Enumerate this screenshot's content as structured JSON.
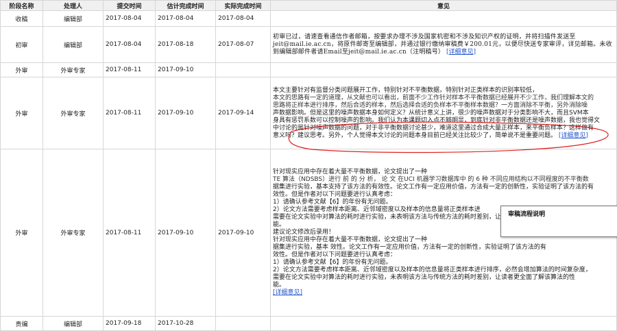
{
  "header": {
    "stage": "阶段名称",
    "handler": "处理人",
    "submitted": "提交时间",
    "estimated": "估计完成时间",
    "actual": "实际完成时间",
    "opinion": "意见"
  },
  "rows": [
    {
      "stage": "收稿",
      "handler": "编辑部",
      "submitted": "2017-08-04",
      "estimated": "2017-08-04",
      "actual": "2017-08-04",
      "opinion": ""
    },
    {
      "stage": "初审",
      "handler": "编辑部",
      "submitted": "2017-08-04",
      "estimated": "2017-08-18",
      "actual": "2017-08-07",
      "opinion": "初审已过，请速查看通信作者邮箱，按要求办理不涉及国家机密和不涉及知识产权的证明，并将扫描件发送至jeit@mail.ie.ac.cn，将原件邮寄至编辑部，并通过银行缴纳审稿费￥200.01元，以便尽快送专家审评，详见邮箱。未收到编辑部邮件者请Email至jeit@mail.ie.ac.cn（注明稿号）"
    },
    {
      "stage": "外审",
      "handler": "外审专家",
      "submitted": "2017-08-11",
      "estimated": "2017-09-10",
      "actual": "",
      "opinion": ""
    },
    {
      "stage": "外审",
      "handler": "外审专家",
      "submitted": "2017-08-11",
      "estimated": "2017-09-10",
      "actual": "2017-09-14",
      "opinion_lines": [
        "本文主要针对有监督分类问题展开工作，特别针对不平衡数据，特别针对正类样本的识别率较低，",
        "本文的思路有一定的道理，从文献也可以看出，前面不少工作针对样本不平衡数据已经展开不少工作，我们理解本文的",
        "思路将正样本进行排序，然后合适的样本，然后选择合适的负样本不平衡样本数据？一方面消除不平衡，另外消除噪",
        "声数据影响。但是这里的噪声数据本身如何定义？从统计意义上讲，很少的噪声数据对于分类影响不大，而且SVM本",
        "身具有惩罚系数可以控制噪声的影响。我们认为本课题切入点不够明显，到底针对非平衡数据还是噪声数据，我也觉得文",
        "中讨论的是针对噪声数据的问题，对于非平衡数据讨论甚少，难道这里通过合成大量正样本，来平衡负样本？这样做有",
        "意义吗？建议思考。另外，个人觉得本文讨论的问题本身目前已经关注比较少了，简单说不是重要问题。"
      ]
    },
    {
      "stage": "外审",
      "handler": "外审专家",
      "submitted": "2017-08-11",
      "estimated": "2017-09-10",
      "actual": "2017-09-10",
      "opinion_lines": [
        "针对现实应用中存在着大量不平衡数据，论文提出了一种",
        "TE 算法（NDSBS）进行 前 的 分 析， 论 文 在UCI 机器学习数据库中  的 6 种 不同应用结构以不同程度的不平衡数",
        "据集进行实验，基本支持了该方法的有效性。论文工作有一定应用价值，方法有一定的创新性，实验证明了该方法的有",
        "效性。但是作者对以下问题要进行认真考虑：",
        "1）请确认参考文献【6】的年份有无问题。",
        "2）论文方法需要考虑样本距离、近邻域密度以及样本的信息量将正类样本进",
        "需要在论文实验中对算法的耗时进行实验，未表明该方法与传统方法的耗时差别，让读者更全面了解该算法的性",
        "能。",
        "建议论文修改后录用！",
        "针对现实应用中存在着大量不平衡数据，论文提出了一种",
        "据集进行实验，基本                          效性。论文工作有一定应用价值，方法有一定的创新性，实验证明了该方法的有",
        "效性。但是作者对以下问题要进行认真考虑：",
        "1）请确认参考文献【6】的年份有无问题。",
        "2）论文方法需要考虑样本距离、近邻域密度以及样本的信息量将正类样本进行排序，必然会增加算法的时间复杂度，",
        "需要在论文实验中对算法的耗时进行实验，未表明该方法与传统方法的耗时差别，让读者更全面了解该算法的性",
        "能。"
      ]
    },
    {
      "stage": "责编",
      "handler": "编辑部",
      "submitted": "2017-09-18",
      "estimated": "2017-10-28",
      "actual": "",
      "opinion": ""
    }
  ],
  "links": {
    "detail": "[详细意见]"
  },
  "tooltip": {
    "title": "审稿流程说明"
  }
}
